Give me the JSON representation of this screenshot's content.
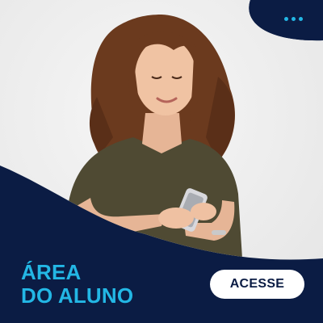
{
  "banner": {
    "title_line1": "ÁREA",
    "title_line2": "DO ALUNO",
    "cta_label": "ACESSE",
    "image_subject": "student-with-phone",
    "menu_icon": "more-dots-icon"
  },
  "colors": {
    "navy": "#0b1c44",
    "accent": "#23b7e5",
    "white": "#ffffff"
  }
}
